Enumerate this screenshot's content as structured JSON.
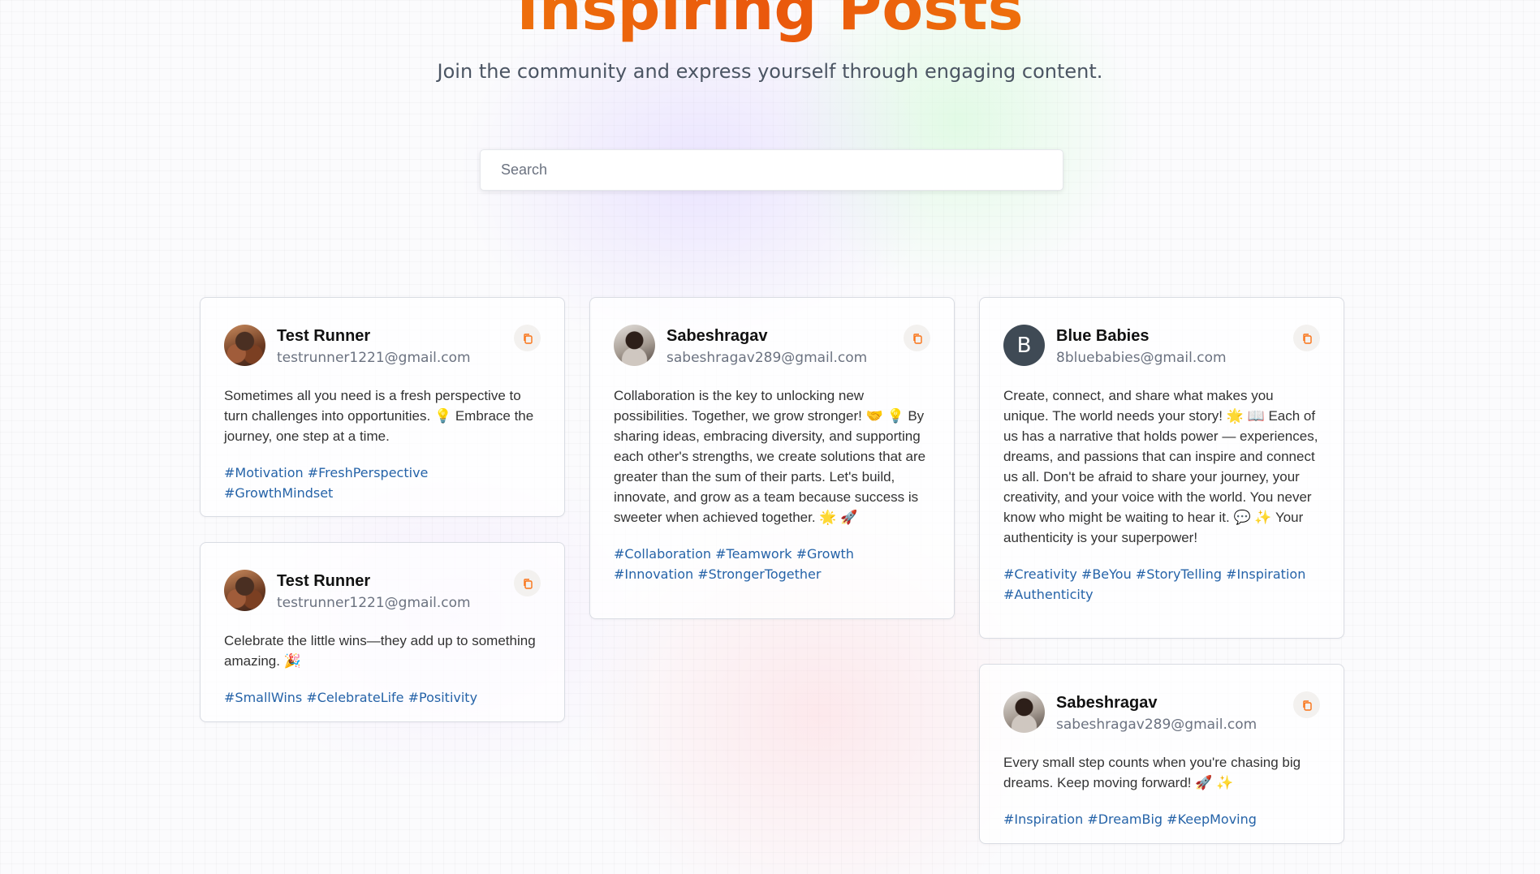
{
  "header": {
    "title": "Inspiring Posts",
    "subtitle": "Join the community and express yourself through engaging content."
  },
  "search": {
    "placeholder": "Search",
    "value": ""
  },
  "icons": {
    "copy": "copy-icon"
  },
  "colors": {
    "title_gradient_start": "#f59e0b",
    "title_gradient_mid": "#ea580c",
    "tag": "#2563a8",
    "copy_icon": "#f97316"
  },
  "posts": [
    {
      "name": "Test Runner",
      "email": "testrunner1221@gmail.com",
      "avatar": "photo",
      "text": "Sometimes all you need is a fresh perspective to turn challenges into opportunities. 💡 Embrace the journey, one step at a time.",
      "tags": "#Motivation #FreshPerspective #GrowthMindset"
    },
    {
      "name": "Test Runner",
      "email": "testrunner1221@gmail.com",
      "avatar": "photo",
      "text": "Celebrate the little wins—they add up to something amazing. 🎉",
      "tags": "#SmallWins #CelebrateLife #Positivity"
    },
    {
      "name": "Sabeshragav",
      "email": "sabeshragav289@gmail.com",
      "avatar": "photo",
      "text": "Collaboration is the key to unlocking new possibilities. Together, we grow stronger! 🤝 💡 By sharing ideas, embracing diversity, and supporting each other's strengths, we create solutions that are greater than the sum of their parts. Let's build, innovate, and grow as a team because success is sweeter when achieved together. 🌟 🚀",
      "tags": "#Collaboration #Teamwork #Growth #Innovation #StrongerTogether"
    },
    {
      "name": "Blue Babies",
      "email": "8bluebabies@gmail.com",
      "avatar_letter": "B",
      "text": "Create, connect, and share what makes you unique. The world needs your story! 🌟 📖 Each of us has a narrative that holds power — experiences, dreams, and passions that can inspire and connect us all. Don't be afraid to share your journey, your creativity, and your voice with the world. You never know who might be waiting to hear it. 💬 ✨ Your authenticity is your superpower!",
      "tags": "#Creativity #BeYou #StoryTelling #Inspiration #Authenticity"
    },
    {
      "name": "Sabeshragav",
      "email": "sabeshragav289@gmail.com",
      "avatar": "photo",
      "text": "Every small step counts when you're chasing big dreams. Keep moving forward! 🚀 ✨",
      "tags": "#Inspiration #DreamBig #KeepMoving"
    }
  ]
}
